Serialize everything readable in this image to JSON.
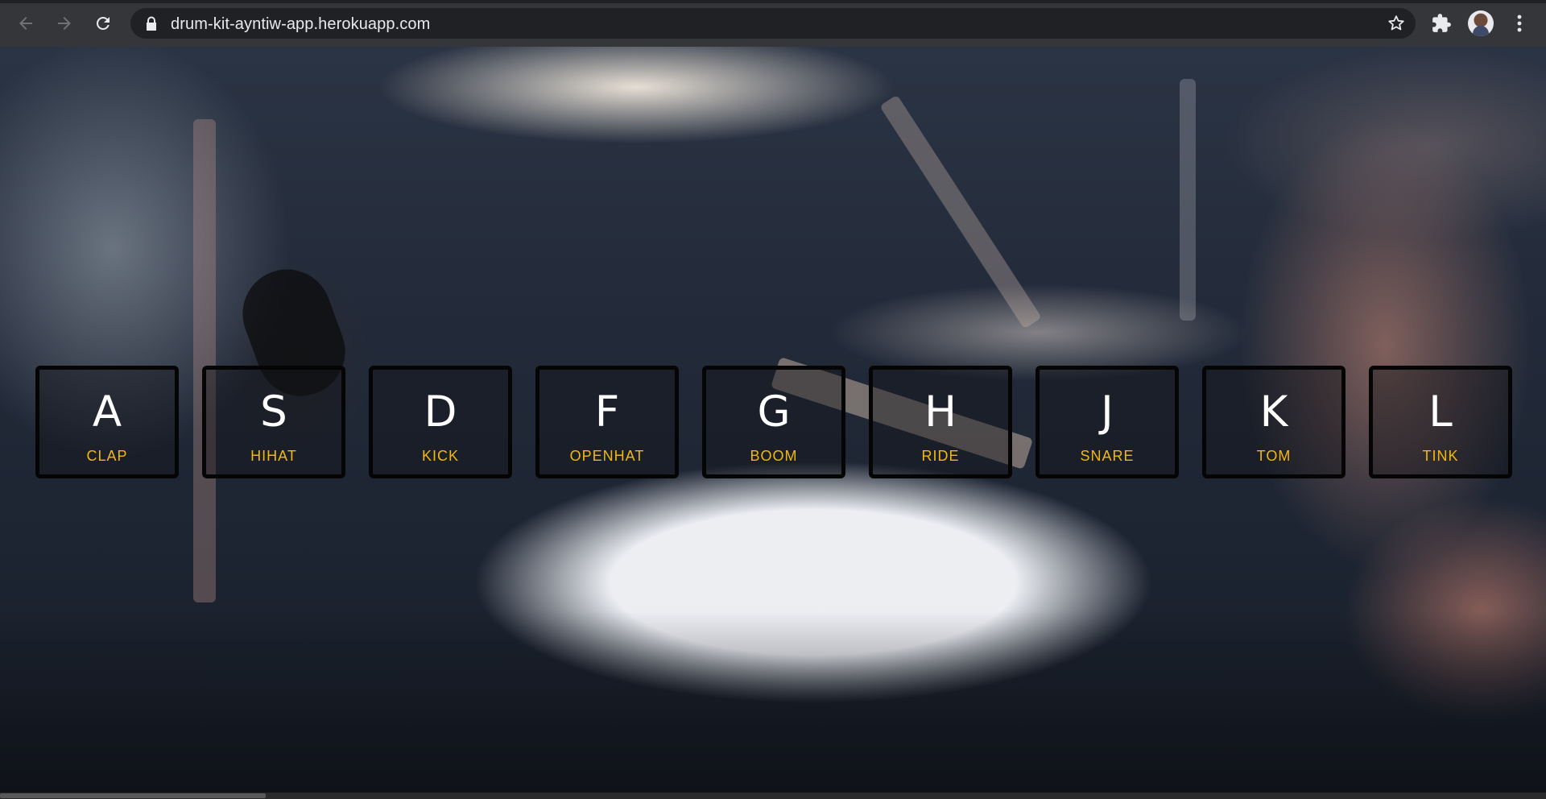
{
  "browser": {
    "url": "drum-kit-ayntiw-app.herokuapp.com",
    "icons": {
      "back": "arrow-left-icon",
      "forward": "arrow-right-icon",
      "reload": "reload-icon",
      "lock": "lock-icon",
      "bookmark": "star-icon",
      "extensions": "puzzle-icon",
      "profile": "avatar",
      "menu": "kebab-menu-icon"
    }
  },
  "colors": {
    "chrome_bg": "#35363a",
    "omnibox_bg": "#202124",
    "key_border": "#050505",
    "key_letter": "#ffffff",
    "key_sound": "#f1b90b"
  },
  "drum_keys": [
    {
      "key": "A",
      "sound": "CLAP"
    },
    {
      "key": "S",
      "sound": "HIHAT"
    },
    {
      "key": "D",
      "sound": "KICK"
    },
    {
      "key": "F",
      "sound": "OPENHAT"
    },
    {
      "key": "G",
      "sound": "BOOM"
    },
    {
      "key": "H",
      "sound": "RIDE"
    },
    {
      "key": "J",
      "sound": "SNARE"
    },
    {
      "key": "K",
      "sound": "TOM"
    },
    {
      "key": "L",
      "sound": "TINK"
    }
  ]
}
